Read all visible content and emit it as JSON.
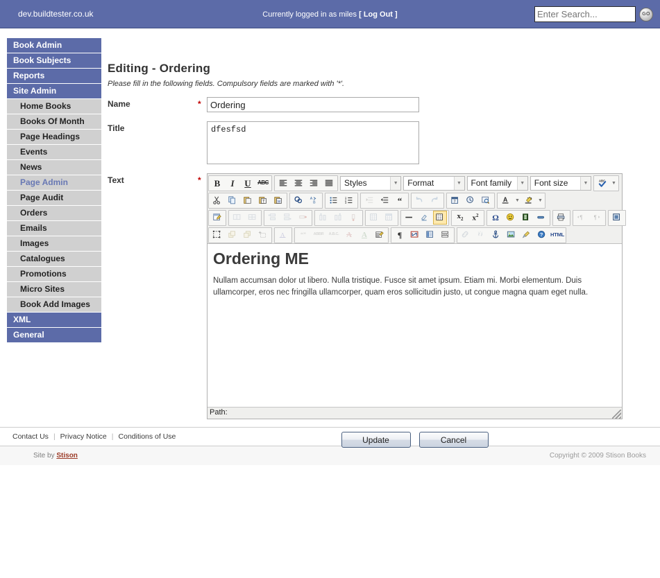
{
  "topbar": {
    "host": "dev.buildtester.co.uk",
    "login_prefix": "Currently logged in as miles",
    "logout_open": "[",
    "logout_label": "Log Out",
    "logout_close": "]",
    "search_placeholder": "Enter Search...",
    "search_value": "",
    "go_label": "GO",
    "bg_color": "#5c6ba8"
  },
  "sidebar": {
    "items": [
      {
        "label": "Book Admin",
        "type": "head",
        "active": false
      },
      {
        "label": "Book Subjects",
        "type": "head",
        "active": false
      },
      {
        "label": "Reports",
        "type": "head",
        "active": false
      },
      {
        "label": "Site Admin",
        "type": "head",
        "active": false
      },
      {
        "label": "Home Books",
        "type": "sub",
        "active": false
      },
      {
        "label": "Books Of Month",
        "type": "sub",
        "active": false
      },
      {
        "label": "Page Headings",
        "type": "sub",
        "active": false
      },
      {
        "label": "Events",
        "type": "sub",
        "active": false
      },
      {
        "label": "News",
        "type": "sub",
        "active": false
      },
      {
        "label": "Page Admin",
        "type": "sub",
        "active": true
      },
      {
        "label": "Page Audit",
        "type": "sub",
        "active": false
      },
      {
        "label": "Orders",
        "type": "sub",
        "active": false
      },
      {
        "label": "Emails",
        "type": "sub",
        "active": false
      },
      {
        "label": "Images",
        "type": "sub",
        "active": false
      },
      {
        "label": "Catalogues",
        "type": "sub",
        "active": false
      },
      {
        "label": "Promotions",
        "type": "sub",
        "active": false
      },
      {
        "label": "Micro Sites",
        "type": "sub",
        "active": false
      },
      {
        "label": "Book Add Images",
        "type": "sub",
        "active": false
      },
      {
        "label": "XML",
        "type": "head",
        "active": false
      },
      {
        "label": "General",
        "type": "head",
        "active": false
      }
    ]
  },
  "main": {
    "title": "Editing - Ordering",
    "instructions": "Please fill in the following fields. Compulsory fields are marked with '*'.",
    "required_marker": "*",
    "fields": {
      "name": {
        "label": "Name",
        "value": "Ordering",
        "required": true
      },
      "title": {
        "label": "Title",
        "value": "dfesfsd",
        "required": false
      },
      "text": {
        "label": "Text",
        "required": true
      }
    },
    "buttons": {
      "update": "Update",
      "cancel": "Cancel"
    }
  },
  "editor": {
    "selects": {
      "styles": "Styles",
      "format": "Format",
      "font_family": "Font family",
      "font_size": "Font size"
    },
    "statusbar_label": "Path:",
    "content": {
      "heading": "Ordering ME",
      "paragraph": "Nullam accumsan dolor ut libero. Nulla tristique. Fusce sit amet ipsum. Etiam mi. Morbi elementum. Duis ullamcorper, eros nec fringilla ullamcorper, quam eros sollicitudin justo, ut congue magna quam eget nulla."
    },
    "html_button_label": "HTML",
    "toolbar_rows": [
      {
        "groups": [
          {
            "buttons": [
              "bold-icon",
              "italic-icon",
              "underline-icon",
              "strikethrough-icon"
            ]
          },
          {
            "buttons": [
              "align-left-icon",
              "align-center-icon",
              "align-right-icon",
              "align-justify-icon"
            ]
          }
        ]
      },
      {
        "groups": [
          {
            "buttons": [
              "cut-icon",
              "copy-icon",
              "paste-icon",
              "paste-text-icon",
              "paste-word-icon"
            ]
          },
          {
            "buttons": [
              "search-icon",
              "replace-icon"
            ]
          },
          {
            "buttons": [
              "bullet-list-icon",
              "numbered-list-icon"
            ]
          },
          {
            "buttons": [
              "outdent-icon",
              "indent-icon",
              "blockquote-icon"
            ]
          },
          {
            "buttons": [
              "undo-icon",
              "redo-icon"
            ]
          },
          {
            "buttons": [
              "insert-date-icon",
              "insert-time-icon",
              "preview-icon"
            ]
          },
          {
            "buttons": [
              "text-color-icon",
              "background-color-icon"
            ]
          }
        ]
      },
      {
        "groups": [
          {
            "buttons": [
              "table-properties-icon"
            ]
          },
          {
            "buttons": [
              "merge-cells-icon",
              "split-cells-icon"
            ]
          },
          {
            "buttons": [
              "insert-row-before-icon",
              "insert-row-after-icon",
              "delete-row-icon"
            ]
          },
          {
            "buttons": [
              "insert-col-before-icon",
              "insert-col-after-icon",
              "delete-col-icon"
            ]
          },
          {
            "buttons": [
              "row-properties-icon",
              "cell-properties-icon"
            ]
          },
          {
            "buttons": [
              "horizontal-rule-icon",
              "remove-format-icon",
              "visual-aid-icon"
            ]
          },
          {
            "buttons": [
              "subscript-icon",
              "superscript-icon"
            ]
          },
          {
            "buttons": [
              "special-char-icon",
              "emoticon-icon",
              "media-icon",
              "flash-icon"
            ]
          },
          {
            "buttons": [
              "print-icon"
            ]
          },
          {
            "buttons": [
              "ltr-icon",
              "rtl-icon"
            ]
          },
          {
            "buttons": [
              "fullscreen-icon"
            ]
          }
        ]
      },
      {
        "groups": [
          {
            "buttons": [
              "select-all-icon",
              "layer-forward-icon",
              "layer-backward-icon",
              "insert-layer-icon"
            ]
          },
          {
            "buttons": [
              "style-props-icon"
            ]
          },
          {
            "buttons": [
              "citation-icon",
              "abbreviation-icon",
              "acronym-icon",
              "delete-text-icon",
              "insert-text-icon",
              "attributes-icon"
            ]
          },
          {
            "buttons": [
              "paragraph-marks-icon",
              "nonbreaking-icon",
              "template-icon",
              "page-break-icon"
            ]
          },
          {
            "buttons": [
              "link-icon",
              "unlink-icon",
              "anchor-icon",
              "image-icon",
              "cleanup-icon",
              "help-icon",
              "html-source-icon"
            ]
          }
        ]
      }
    ]
  },
  "footer": {
    "links": [
      "Contact Us",
      "Privacy Notice",
      "Conditions of Use"
    ],
    "separator": "|",
    "site_by_prefix": "Site by",
    "site_by_brand": "Stison",
    "copyright": "Copyright © 2009 Stison Books"
  }
}
